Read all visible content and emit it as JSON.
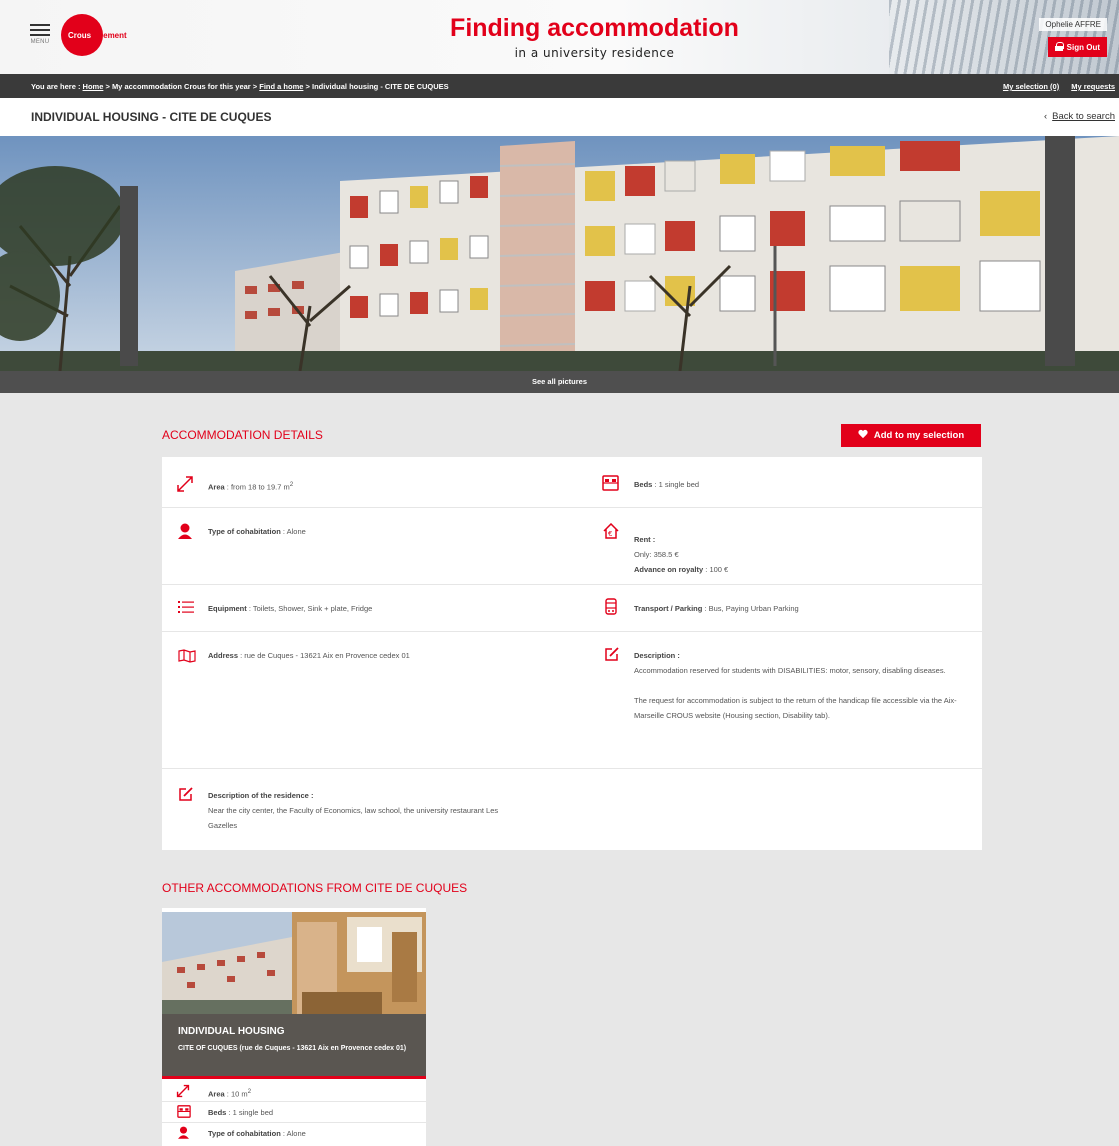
{
  "header": {
    "menu_label": "MENU",
    "logo_text_white": "Crous",
    "logo_text_red": "logement",
    "title": "Finding accommodation",
    "subtitle": "in a university residence",
    "user_name": "Ophelie AFFRE",
    "sign_out": "Sign Out"
  },
  "breadcrumb": {
    "prefix": "You are here : ",
    "home": "Home",
    "sep1": " > My accommodation Crous for this year > ",
    "find": "Find a home",
    "sep2": " > Individual housing - CITE DE CUQUES",
    "my_selection": "My selection (0)",
    "my_requests": "My requests"
  },
  "page": {
    "title": "INDIVIDUAL HOUSING - CITE DE CUQUES",
    "back": "Back to search",
    "see_all": "See all pictures"
  },
  "details": {
    "section_title": "ACCOMMODATION DETAILS",
    "add_button": "Add to my selection",
    "area_label": "Area",
    "area_value": " : from 18 to 19.7 m",
    "beds_label": "Beds",
    "beds_value": " : 1 single bed",
    "cohab_label": "Type of cohabitation",
    "cohab_value": " : Alone",
    "rent_label": "Rent :",
    "rent_only": "Only: 358.5 €",
    "rent_advance_label": "Advance on royalty",
    "rent_advance_value": " : 100 €",
    "equip_label": "Equipment",
    "equip_value": " : Toilets, Shower, Sink + plate, Fridge",
    "transport_label": "Transport / Parking",
    "transport_value": " : Bus, Paying Urban Parking",
    "address_label": "Address",
    "address_value": " : rue de Cuques - 13621 Aix en Provence cedex 01",
    "desc_label": "Description :",
    "desc_p1": "Accommodation reserved for students with DISABILITIES: motor, sensory, disabling diseases.",
    "desc_p2": "The request for accommodation is subject to the return of the handicap file accessible via the Aix-Marseille CROUS website (Housing section, Disability tab).",
    "residence_label": "Description of the residence :",
    "residence_value": "Near the city center, the Faculty of Economics, law school, the university restaurant Les Gazelles"
  },
  "others": {
    "section_title": "OTHER ACCOMMODATIONS FROM CITE DE CUQUES",
    "card": {
      "title": "INDIVIDUAL HOUSING",
      "address": "CITE OF CUQUES (rue de Cuques - 13621 Aix en Provence cedex 01)",
      "area_label": "Area",
      "area_value": " : 10 m",
      "beds_label": "Beds",
      "beds_value": " : 1 single bed",
      "cohab_label": "Type of cohabitation",
      "cohab_value": " : Alone"
    }
  },
  "superscript": "2",
  "colors": {
    "brand_red": "#e2001a",
    "dark_bar": "#3a3a3a",
    "background": "#e7e7e7"
  },
  "icons": [
    "menu-icon",
    "lock-icon",
    "chevron-left-icon",
    "heart-icon",
    "resize-arrow-icon",
    "bed-icon",
    "person-icon",
    "house-euro-icon",
    "list-icon",
    "building-icon",
    "map-icon",
    "edit-icon"
  ]
}
